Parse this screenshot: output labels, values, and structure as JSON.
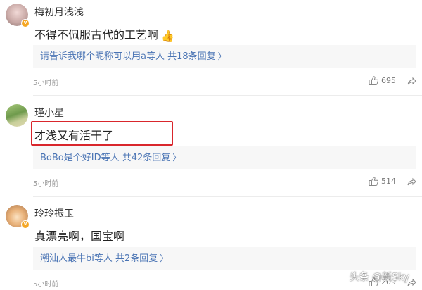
{
  "comments": [
    {
      "username": "梅初月浅浅",
      "text": "不得不佩服古代的工艺啊",
      "emoji": "👍",
      "reply_summary": "请告诉我哪个昵称可以用a等人 共18条回复",
      "time": "5小时前",
      "likes": "695",
      "verified_badge": "v"
    },
    {
      "username": "瑾小星",
      "text": "才浅又有活干了",
      "reply_summary": "BoBo是个好ID等人 共42条回复",
      "time": "5小时前",
      "likes": "514"
    },
    {
      "username": "玲玲振玉",
      "text": "真漂亮啊，国宝啊",
      "reply_summary": "潮汕人最牛bi等人 共2条回复",
      "time": "5小时前",
      "likes": "209",
      "verified_badge": "v"
    }
  ],
  "chevron": "〉",
  "watermark": "头条 @新Sky",
  "colors": {
    "link": "#4a74b4",
    "highlight_border": "#d9262c",
    "reply_bg": "#f7f7f7",
    "badge": "#f5a623"
  },
  "icons": [
    "like-icon",
    "share-icon",
    "verified-badge-icon",
    "thumbs-up-emoji"
  ]
}
